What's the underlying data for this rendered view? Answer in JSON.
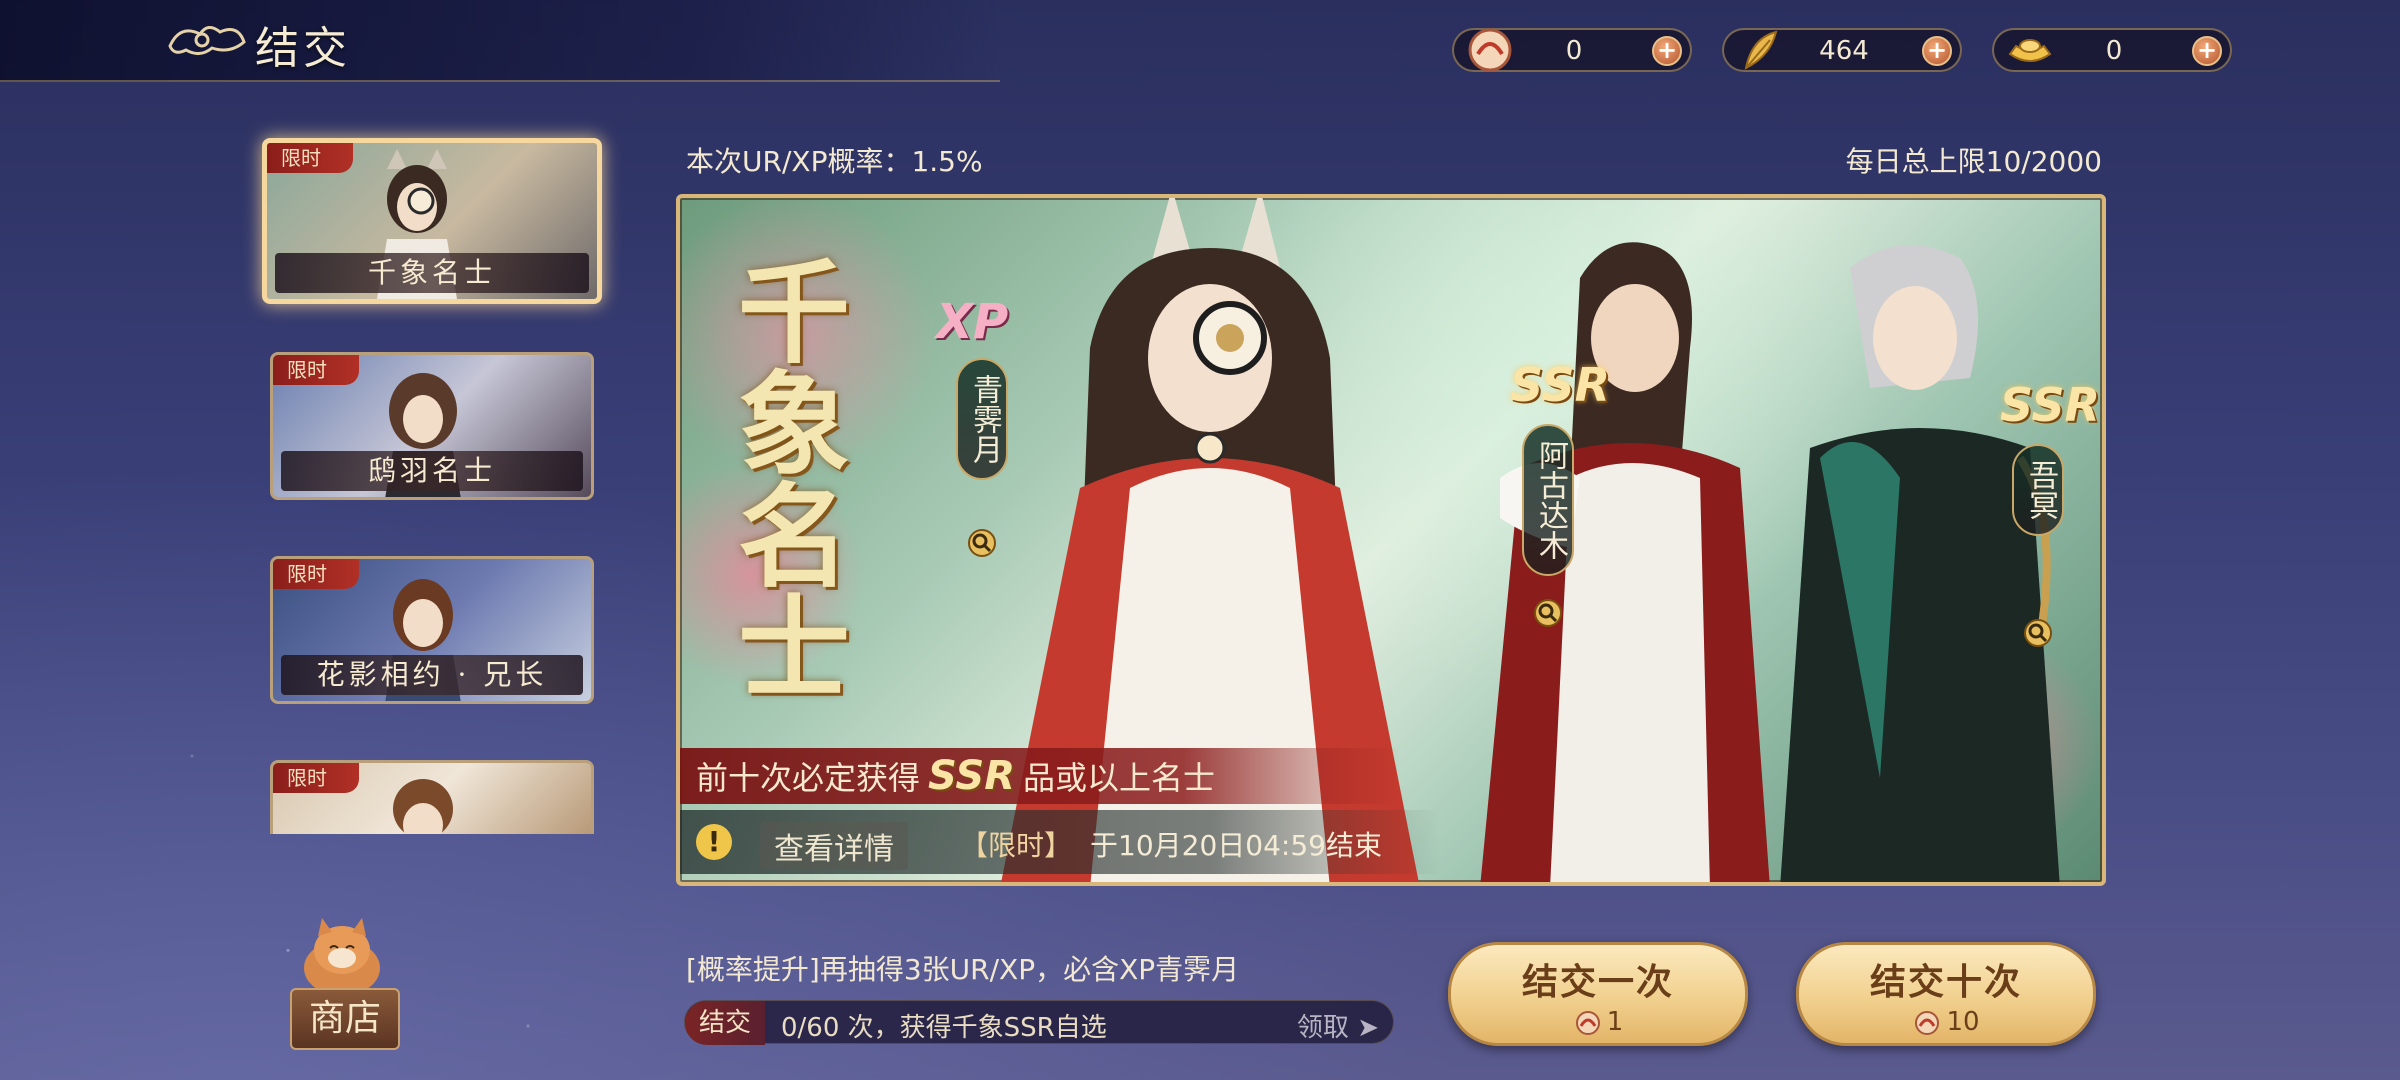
{
  "header": {
    "title": "结交",
    "currencies": [
      {
        "name": "summon-token",
        "amount": "0",
        "icon": "summon-token-icon"
      },
      {
        "name": "feather",
        "amount": "464",
        "icon": "feather-icon"
      },
      {
        "name": "gold-ingot",
        "amount": "0",
        "icon": "gold-ingot-icon"
      }
    ]
  },
  "banners": [
    {
      "tag": "限时",
      "name": "千象名士",
      "active": true
    },
    {
      "tag": "限时",
      "name": "鸱羽名士",
      "active": false
    },
    {
      "tag": "限时",
      "name": "花影相约 · 兄长",
      "active": false
    },
    {
      "tag": "限时",
      "name": "",
      "active": false
    }
  ],
  "main": {
    "rate_text": "本次UR/XP概率：1.5%",
    "daily_limit": "每日总上限10/2000",
    "big_title": "千象名士",
    "featured": [
      {
        "rarity": "XP",
        "name": "青霁月"
      },
      {
        "rarity": "SSR",
        "name": "阿古达木"
      },
      {
        "rarity": "SSR",
        "name": "吾冥"
      }
    ],
    "guarantee_prefix": "前十次必定获得",
    "guarantee_rarity": "SSR",
    "guarantee_suffix": "品或以上名士",
    "view_details": "查看详情",
    "limited_tag": "【限时】",
    "end_time": "于10月20日04:59结束"
  },
  "bottom": {
    "bonus_text": "[概率提升]再抽得3张UR/XP，必含XP青霁月",
    "progress_label": "结交",
    "progress_text": "0/60 次，获得千象SSR自选",
    "claim_label": "领取",
    "progress_value": 0,
    "draw_once_label": "结交一次",
    "draw_once_cost": "1",
    "draw_ten_label": "结交十次",
    "draw_ten_cost": "10",
    "shop_label": "商店"
  },
  "colors": {
    "accent_gold": "#d9b679",
    "limited_red": "#b13026",
    "button_gold": "#f1d08e"
  }
}
